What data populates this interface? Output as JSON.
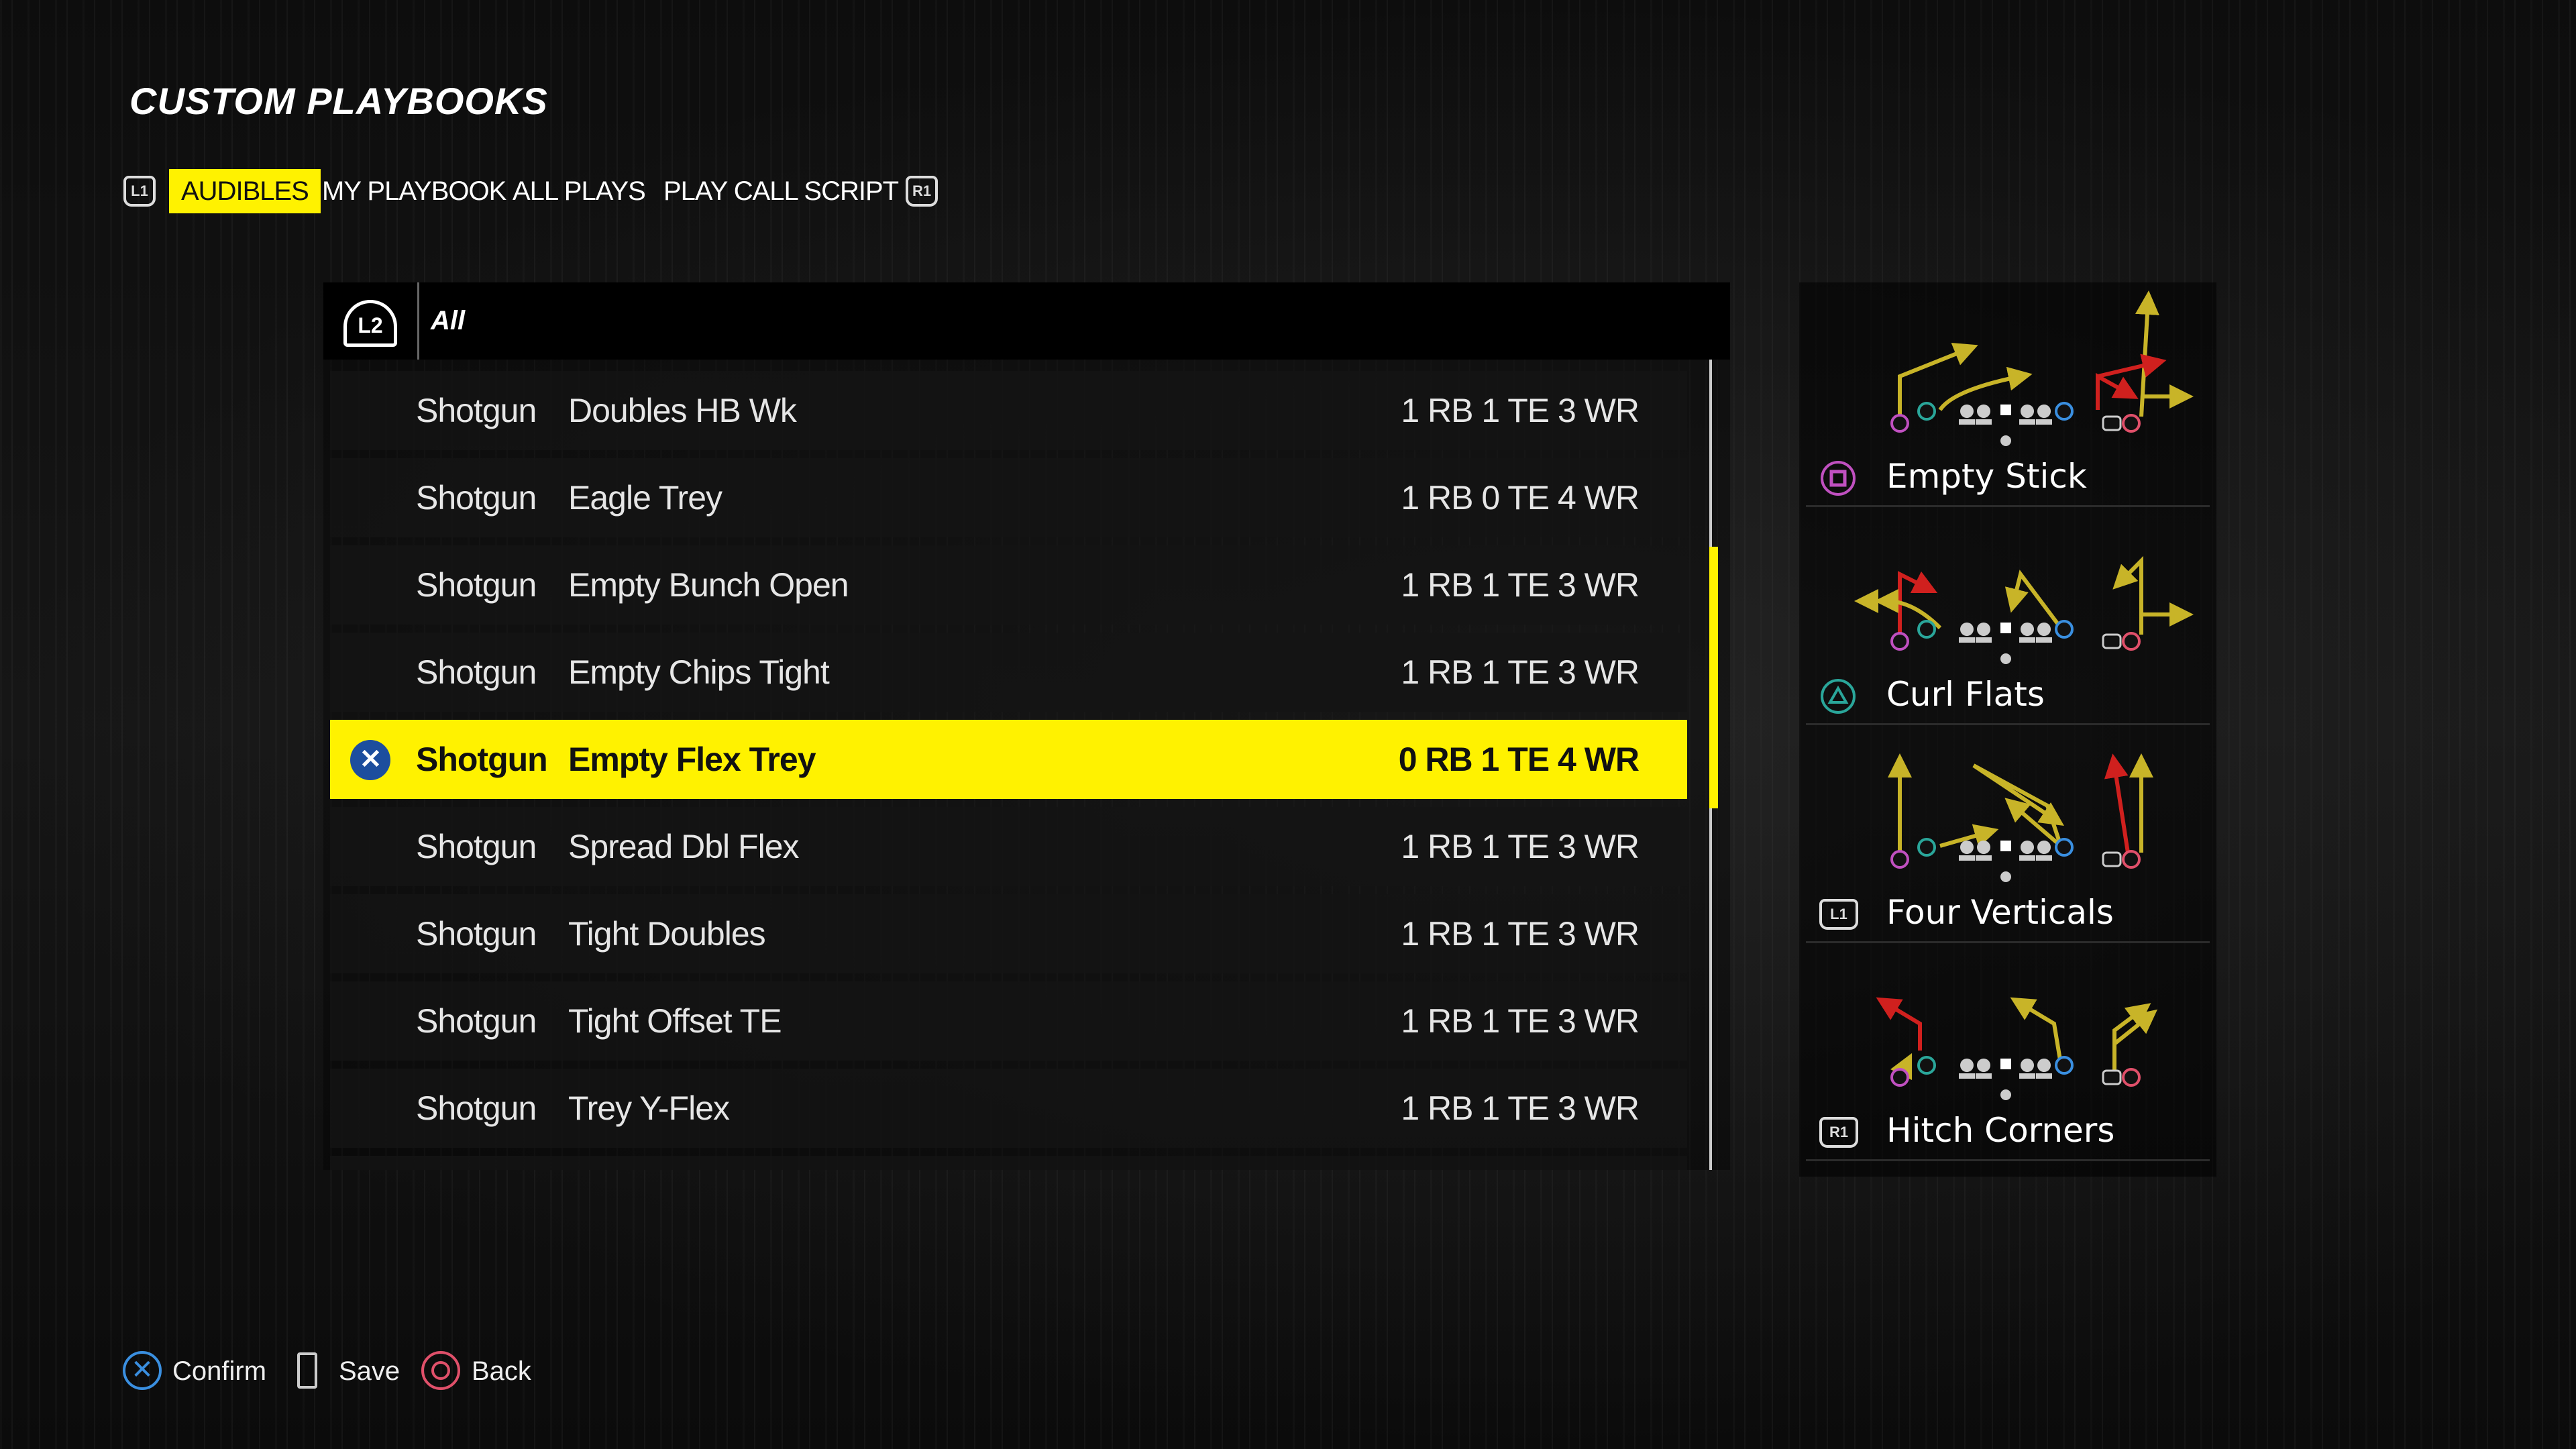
{
  "title": "CUSTOM PLAYBOOKS",
  "tabs": {
    "left_bumper": "L1",
    "right_bumper": "R1",
    "items": [
      {
        "label": "AUDIBLES",
        "active": true
      },
      {
        "label": "MY PLAYBOOK"
      },
      {
        "label": "ALL PLAYS"
      },
      {
        "label": "PLAY CALL SCRIPT"
      }
    ]
  },
  "filter": {
    "button": "L2",
    "value": "All"
  },
  "rows": [
    {
      "formation": "Shotgun",
      "name": "Doubles HB Wk",
      "personnel": "1 RB 1 TE 3 WR"
    },
    {
      "formation": "Shotgun",
      "name": "Eagle Trey",
      "personnel": "1 RB 0 TE 4 WR"
    },
    {
      "formation": "Shotgun",
      "name": "Empty Bunch Open",
      "personnel": "1 RB 1 TE 3 WR"
    },
    {
      "formation": "Shotgun",
      "name": "Empty Chips Tight",
      "personnel": "1 RB 1 TE 3 WR"
    },
    {
      "formation": "Shotgun",
      "name": "Empty Flex Trey",
      "personnel": "0 RB 1 TE 4 WR",
      "selected": true
    },
    {
      "formation": "Shotgun",
      "name": "Spread Dbl Flex",
      "personnel": "1 RB 1 TE 3 WR"
    },
    {
      "formation": "Shotgun",
      "name": "Tight Doubles",
      "personnel": "1 RB 1 TE 3 WR"
    },
    {
      "formation": "Shotgun",
      "name": "Tight Offset TE",
      "personnel": "1 RB 1 TE 3 WR"
    },
    {
      "formation": "Shotgun",
      "name": "Trey Y-Flex",
      "personnel": "1 RB 1 TE 3 WR"
    }
  ],
  "audibles": [
    {
      "button": "square",
      "label": "Empty Stick"
    },
    {
      "button": "triangle",
      "label": "Curl Flats"
    },
    {
      "button": "L1",
      "label": "Four Verticals"
    },
    {
      "button": "R1",
      "label": "Hitch Corners"
    }
  ],
  "footer": [
    {
      "icon": "cross-icon",
      "label": "Confirm"
    },
    {
      "icon": "options-icon",
      "label": "Save"
    },
    {
      "icon": "circle-icon",
      "label": "Back"
    }
  ],
  "colors": {
    "accent": "#fff200",
    "route": "#c8b428",
    "hot_route": "#d0201e",
    "square": "#c050c0",
    "triangle": "#2aa69a",
    "cross": "#3a8fe0",
    "circle": "#e0506a"
  }
}
